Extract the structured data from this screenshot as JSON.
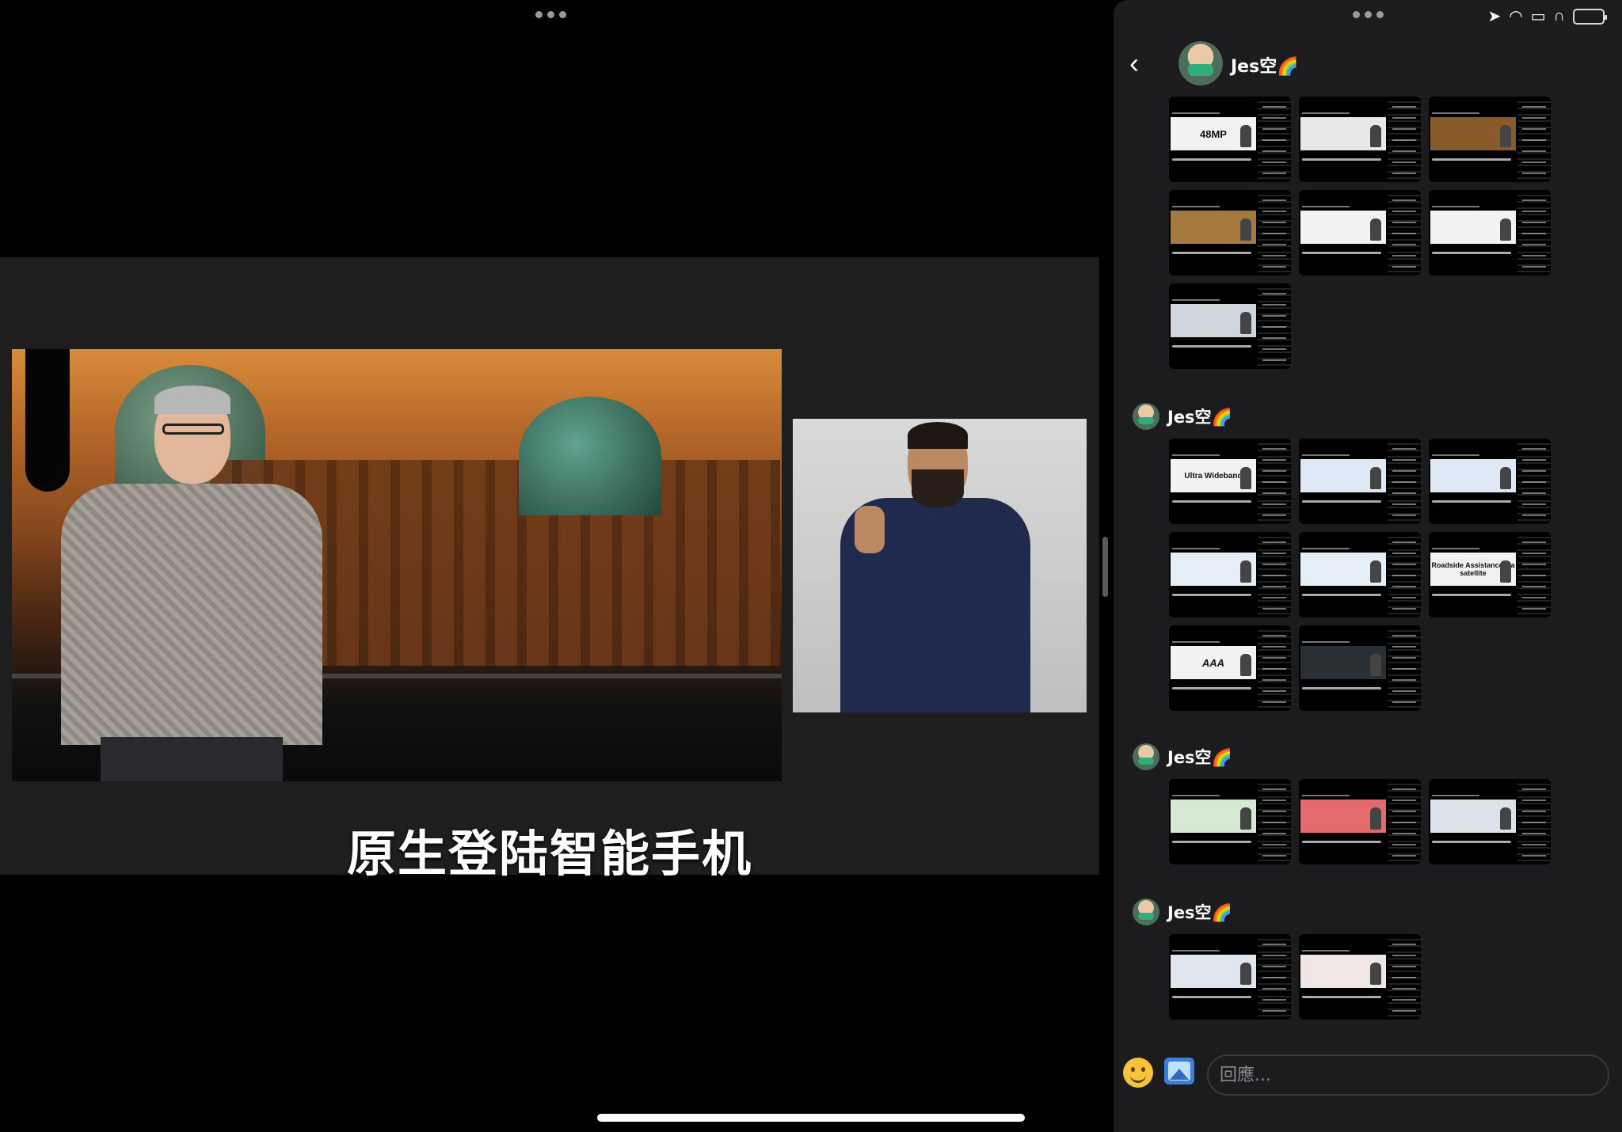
{
  "video": {
    "subtitle": "原生登陆智能手机"
  },
  "status_bar": {
    "icons": [
      "location-arrow-icon",
      "wifi-icon",
      "car-icon",
      "headphones-icon",
      "battery-charging-icon"
    ],
    "battery_color": "#34c759"
  },
  "chat": {
    "contact_name": "Jes空🌈",
    "reply_placeholder": "回應...",
    "groups": [
      {
        "sender": "Jes空🌈",
        "thumbnails": [
          {
            "slide_text": "48MP"
          },
          {
            "slide_text": ""
          },
          {
            "slide_text": ""
          },
          {
            "slide_text": ""
          },
          {
            "slide_text": ""
          },
          {
            "slide_text": ""
          },
          {
            "slide_text": ""
          }
        ]
      },
      {
        "sender": "Jes空🌈",
        "thumbnails": [
          {
            "slide_text": "Ultra Wideband"
          },
          {
            "slide_text": ""
          },
          {
            "slide_text": ""
          },
          {
            "slide_text": ""
          },
          {
            "slide_text": ""
          },
          {
            "slide_text": "Roadside Assistance via satellite"
          },
          {
            "slide_text": "AAA"
          },
          {
            "slide_text": ""
          }
        ]
      },
      {
        "sender": "Jes空🌈",
        "thumbnails": [
          {
            "slide_text": ""
          },
          {
            "slide_text": ""
          },
          {
            "slide_text": ""
          }
        ]
      },
      {
        "sender": "Jes空🌈",
        "thumbnails": [
          {
            "slide_text": ""
          },
          {
            "slide_text": ""
          }
        ]
      }
    ]
  },
  "colors": {
    "chat_background": "#1c1c1e",
    "video_stage": "#1e1e1f"
  }
}
